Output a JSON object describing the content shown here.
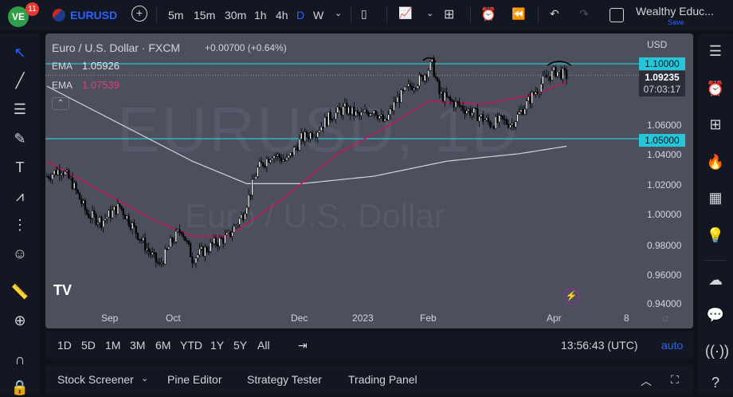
{
  "toolbar": {
    "notif_count": "11",
    "symbol": "EURUSD",
    "intervals": [
      "5m",
      "15m",
      "30m",
      "1h",
      "4h",
      "D",
      "W"
    ],
    "account": "Wealthy Educ...",
    "save": "Save"
  },
  "legend": {
    "title": "Euro / U.S. Dollar · FXCM",
    "change": "+0.00700 (+0.64%)",
    "ema1_label": "EMA",
    "ema1_value": "1.05926",
    "ema2_label": "EMA",
    "ema2_value": "1.07539"
  },
  "watermark": {
    "big": "EURUSD, 1D",
    "small": "Euro / U.S. Dollar"
  },
  "price_axis": {
    "currency": "USD",
    "ticks": [
      "1.06000",
      "1.04000",
      "1.02000",
      "1.00000",
      "0.98000",
      "0.96000",
      "0.94000"
    ],
    "line_high": "1.10000",
    "line_low": "1.05000",
    "last_price": "1.09235",
    "countdown": "07:03:17"
  },
  "time_axis": [
    "Sep",
    "Oct",
    "Dec",
    "2023",
    "Feb",
    "Apr",
    "8"
  ],
  "timeframes": [
    "1D",
    "5D",
    "1M",
    "3M",
    "6M",
    "YTD",
    "1Y",
    "5Y",
    "All"
  ],
  "clock": "13:56:43 (UTC)",
  "auto": "auto",
  "bottom_tabs": [
    "Stock Screener",
    "Pine Editor",
    "Strategy Tester",
    "Trading Panel"
  ],
  "colors": {
    "accent": "#2962ff",
    "hline": "#26c6da",
    "ema_fast": "#c2185b",
    "ema_slow": "#d1d4dc",
    "panel": "#4c505c"
  },
  "chart_data": {
    "type": "candlestick",
    "symbol": "EURUSD",
    "timeframe": "1D",
    "ylim": [
      0.93,
      1.115
    ],
    "close_path": [
      [
        0,
        1.025
      ],
      [
        8,
        1.03
      ],
      [
        14,
        1.02
      ],
      [
        22,
        1.0
      ],
      [
        30,
        0.995
      ],
      [
        40,
        1.005
      ],
      [
        48,
        0.99
      ],
      [
        56,
        0.975
      ],
      [
        62,
        0.965
      ],
      [
        68,
        0.98
      ],
      [
        74,
        0.99
      ],
      [
        80,
        0.97
      ],
      [
        86,
        0.975
      ],
      [
        92,
        0.98
      ],
      [
        100,
        0.985
      ],
      [
        108,
        1.0
      ],
      [
        116,
        1.03
      ],
      [
        124,
        1.04
      ],
      [
        132,
        1.035
      ],
      [
        140,
        1.05
      ],
      [
        148,
        1.055
      ],
      [
        156,
        1.065
      ],
      [
        164,
        1.07
      ],
      [
        172,
        1.065
      ],
      [
        180,
        1.07
      ],
      [
        186,
        1.06
      ],
      [
        192,
        1.075
      ],
      [
        200,
        1.085
      ],
      [
        206,
        1.09
      ],
      [
        212,
        1.1
      ],
      [
        216,
        1.08
      ],
      [
        222,
        1.075
      ],
      [
        230,
        1.07
      ],
      [
        238,
        1.065
      ],
      [
        244,
        1.06
      ],
      [
        250,
        1.062
      ],
      [
        256,
        1.06
      ],
      [
        262,
        1.07
      ],
      [
        268,
        1.08
      ],
      [
        274,
        1.09
      ],
      [
        280,
        1.095
      ],
      [
        286,
        1.092
      ]
    ],
    "ema_fast_path": [
      [
        0,
        1.035
      ],
      [
        30,
        1.015
      ],
      [
        60,
        0.995
      ],
      [
        80,
        0.985
      ],
      [
        100,
        0.985
      ],
      [
        130,
        1.01
      ],
      [
        160,
        1.04
      ],
      [
        190,
        1.06
      ],
      [
        210,
        1.075
      ],
      [
        240,
        1.073
      ],
      [
        270,
        1.08
      ],
      [
        286,
        1.088
      ]
    ],
    "ema_slow_path": [
      [
        0,
        1.085
      ],
      [
        40,
        1.06
      ],
      [
        80,
        1.035
      ],
      [
        110,
        1.02
      ],
      [
        140,
        1.02
      ],
      [
        180,
        1.025
      ],
      [
        220,
        1.035
      ],
      [
        260,
        1.04
      ],
      [
        286,
        1.045
      ]
    ],
    "hlines": [
      1.1,
      1.05
    ]
  }
}
